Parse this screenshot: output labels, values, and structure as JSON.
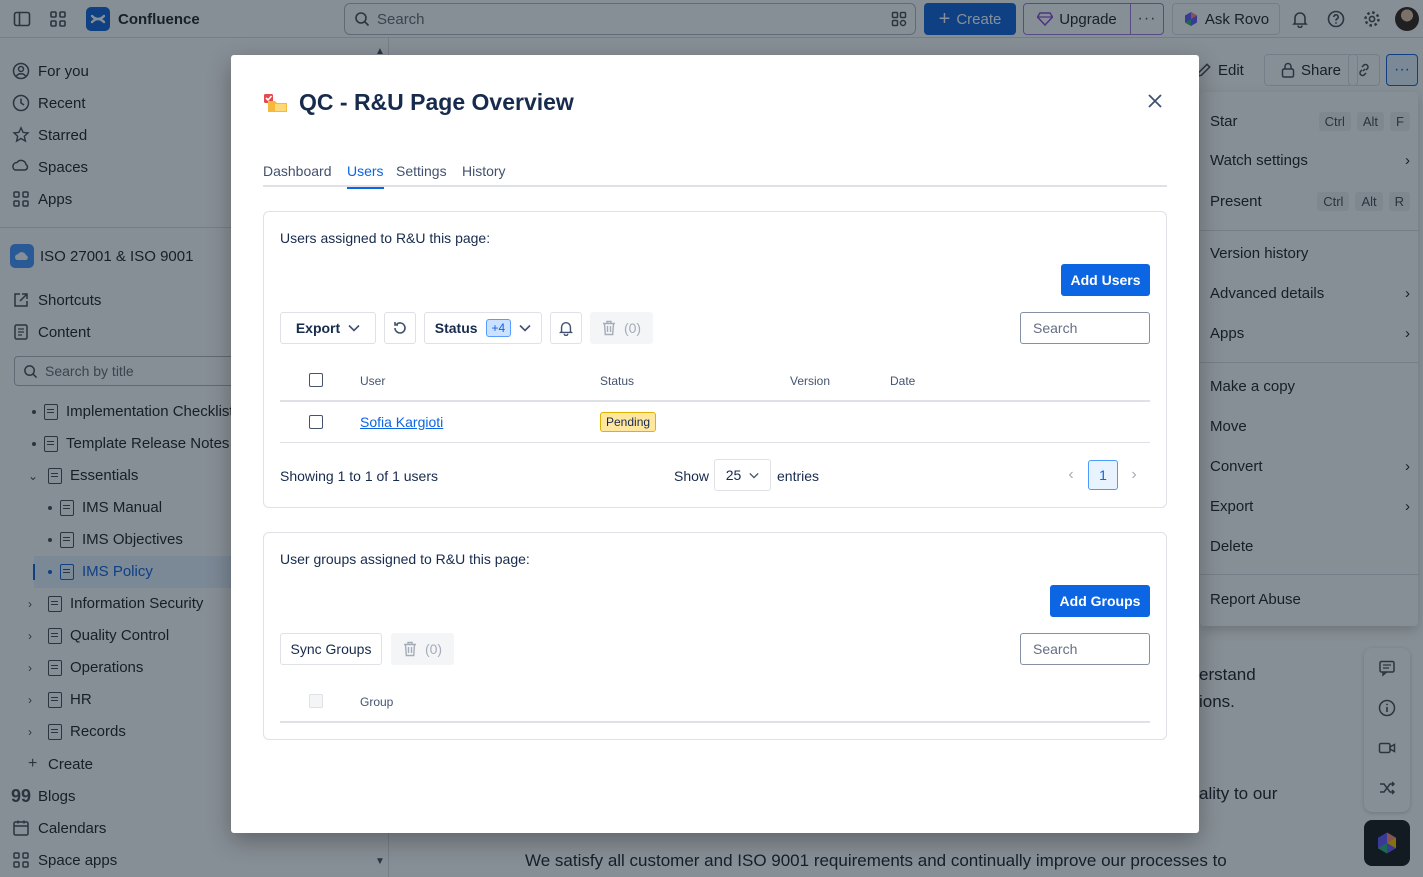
{
  "topbar": {
    "product_name": "Confluence",
    "search_placeholder": "Search",
    "create_label": "Create",
    "upgrade_label": "Upgrade",
    "rovo_label": "Ask Rovo"
  },
  "sidebar": {
    "nav": [
      {
        "label": "For you",
        "icon": "user-circle-icon"
      },
      {
        "label": "Recent",
        "icon": "clock-icon"
      },
      {
        "label": "Starred",
        "icon": "star-icon"
      },
      {
        "label": "Spaces",
        "icon": "spaces-icon"
      },
      {
        "label": "Apps",
        "icon": "apps-icon"
      }
    ],
    "space_name": "ISO 27001 & ISO 9001",
    "shortcuts_label": "Shortcuts",
    "content_label": "Content",
    "search_placeholder": "Search by title",
    "tree": [
      {
        "label": "Implementation Checklist",
        "level": 1,
        "kind": "bullet"
      },
      {
        "label": "Template Release Notes",
        "level": 1,
        "kind": "bullet"
      },
      {
        "label": "Essentials",
        "level": 1,
        "kind": "expanded"
      },
      {
        "label": "IMS Manual",
        "level": 2,
        "kind": "bullet"
      },
      {
        "label": "IMS Objectives",
        "level": 2,
        "kind": "bullet"
      },
      {
        "label": "IMS Policy",
        "level": 2,
        "kind": "bullet",
        "active": true
      },
      {
        "label": "Information Security",
        "level": 1,
        "kind": "collapsed"
      },
      {
        "label": "Quality Control",
        "level": 1,
        "kind": "collapsed"
      },
      {
        "label": "Operations",
        "level": 1,
        "kind": "collapsed"
      },
      {
        "label": "HR",
        "level": 1,
        "kind": "collapsed"
      },
      {
        "label": "Records",
        "level": 1,
        "kind": "collapsed"
      }
    ],
    "create_label": "Create",
    "blogs_label": "Blogs",
    "calendars_label": "Calendars",
    "space_apps_label": "Space apps"
  },
  "page_actions": {
    "edit_label": "Edit",
    "share_label": "Share"
  },
  "more_menu": {
    "items": [
      {
        "label": "Star",
        "shortcut": [
          "Ctrl",
          "Alt",
          "F"
        ]
      },
      {
        "label": "Watch settings",
        "submenu": true
      },
      {
        "label": "Present",
        "shortcut": [
          "Ctrl",
          "Alt",
          "R"
        ]
      },
      {
        "label": "Version history"
      },
      {
        "label": "Advanced details",
        "submenu": true
      },
      {
        "label": "Apps",
        "submenu": true
      },
      {
        "label": "Make a copy"
      },
      {
        "label": "Move"
      },
      {
        "label": "Convert",
        "submenu": true
      },
      {
        "label": "Export",
        "submenu": true
      },
      {
        "label": "Delete"
      },
      {
        "label": "Report Abuse"
      }
    ]
  },
  "page_body": {
    "fragment_1": "erstand",
    "fragment_2": "ions.",
    "fragment_3": "ality to our",
    "line_bottom": "We satisfy all customer and ISO 9001 requirements and continually improve our processes to"
  },
  "modal": {
    "title": "QC - R&U Page Overview",
    "tabs": [
      {
        "label": "Dashboard",
        "active": false
      },
      {
        "label": "Users",
        "active": true
      },
      {
        "label": "Settings",
        "active": false
      },
      {
        "label": "History",
        "active": false
      }
    ],
    "users_card": {
      "heading": "Users assigned to R&U this page:",
      "add_label": "Add Users",
      "export_label": "Export",
      "status_label": "Status",
      "status_badge": "+4",
      "delete_count": "(0)",
      "search_placeholder": "Search",
      "columns": [
        "User",
        "Status",
        "Version",
        "Date"
      ],
      "rows": [
        {
          "user": "Sofia Kargioti",
          "status": "Pending",
          "version": "",
          "date": ""
        }
      ],
      "showing_text": "Showing 1 to 1 of 1 users",
      "show_label": "Show",
      "page_size": "25",
      "entries_label": "entries",
      "current_page": "1"
    },
    "groups_card": {
      "heading": "User groups assigned to R&U this page:",
      "add_label": "Add Groups",
      "sync_label": "Sync Groups",
      "delete_count": "(0)",
      "search_placeholder": "Search",
      "columns": [
        "Group"
      ]
    }
  }
}
